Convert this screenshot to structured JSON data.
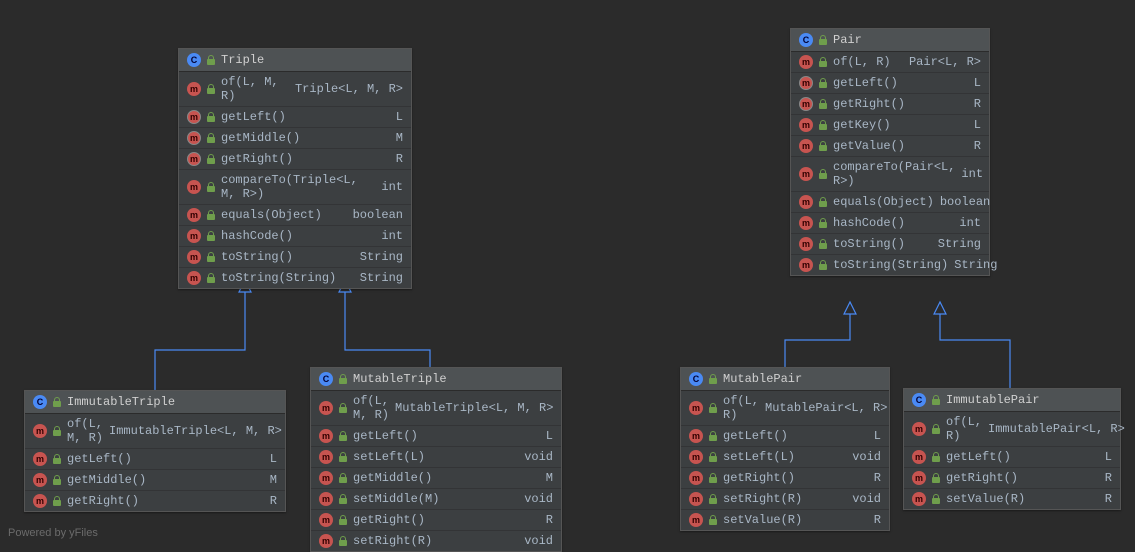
{
  "footer": "Powered by yFiles",
  "classes": {
    "triple": {
      "name": "Triple",
      "members": [
        {
          "icon": "m",
          "name": "of(L, M, R)",
          "ret": "Triple<L, M, R>"
        },
        {
          "icon": "mi",
          "name": "getLeft()",
          "ret": "L"
        },
        {
          "icon": "mi",
          "name": "getMiddle()",
          "ret": "M"
        },
        {
          "icon": "mi",
          "name": "getRight()",
          "ret": "R"
        },
        {
          "icon": "m",
          "name": "compareTo(Triple<L, M, R>)",
          "ret": "int"
        },
        {
          "icon": "m",
          "name": "equals(Object)",
          "ret": "boolean"
        },
        {
          "icon": "m",
          "name": "hashCode()",
          "ret": "int"
        },
        {
          "icon": "m",
          "name": "toString()",
          "ret": "String"
        },
        {
          "icon": "m",
          "name": "toString(String)",
          "ret": "String"
        }
      ]
    },
    "pair": {
      "name": "Pair",
      "members": [
        {
          "icon": "m",
          "name": "of(L, R)",
          "ret": "Pair<L, R>"
        },
        {
          "icon": "mi",
          "name": "getLeft()",
          "ret": "L"
        },
        {
          "icon": "mi",
          "name": "getRight()",
          "ret": "R"
        },
        {
          "icon": "m",
          "name": "getKey()",
          "ret": "L"
        },
        {
          "icon": "m",
          "name": "getValue()",
          "ret": "R"
        },
        {
          "icon": "m",
          "name": "compareTo(Pair<L, R>)",
          "ret": "int"
        },
        {
          "icon": "m",
          "name": "equals(Object)",
          "ret": "boolean"
        },
        {
          "icon": "m",
          "name": "hashCode()",
          "ret": "int"
        },
        {
          "icon": "m",
          "name": "toString()",
          "ret": "String"
        },
        {
          "icon": "m",
          "name": "toString(String)",
          "ret": "String"
        }
      ]
    },
    "immutableTriple": {
      "name": "ImmutableTriple",
      "members": [
        {
          "icon": "m",
          "name": "of(L, M, R)",
          "ret": "ImmutableTriple<L, M, R>"
        },
        {
          "icon": "m",
          "name": "getLeft()",
          "ret": "L"
        },
        {
          "icon": "m",
          "name": "getMiddle()",
          "ret": "M"
        },
        {
          "icon": "m",
          "name": "getRight()",
          "ret": "R"
        }
      ]
    },
    "mutableTriple": {
      "name": "MutableTriple",
      "members": [
        {
          "icon": "m",
          "name": "of(L, M, R)",
          "ret": "MutableTriple<L, M, R>"
        },
        {
          "icon": "m",
          "name": "getLeft()",
          "ret": "L"
        },
        {
          "icon": "m",
          "name": "setLeft(L)",
          "ret": "void"
        },
        {
          "icon": "m",
          "name": "getMiddle()",
          "ret": "M"
        },
        {
          "icon": "m",
          "name": "setMiddle(M)",
          "ret": "void"
        },
        {
          "icon": "m",
          "name": "getRight()",
          "ret": "R"
        },
        {
          "icon": "m",
          "name": "setRight(R)",
          "ret": "void"
        }
      ]
    },
    "mutablePair": {
      "name": "MutablePair",
      "members": [
        {
          "icon": "m",
          "name": "of(L, R)",
          "ret": "MutablePair<L, R>"
        },
        {
          "icon": "m",
          "name": "getLeft()",
          "ret": "L"
        },
        {
          "icon": "m",
          "name": "setLeft(L)",
          "ret": "void"
        },
        {
          "icon": "m",
          "name": "getRight()",
          "ret": "R"
        },
        {
          "icon": "m",
          "name": "setRight(R)",
          "ret": "void"
        },
        {
          "icon": "m",
          "name": "setValue(R)",
          "ret": "R"
        }
      ]
    },
    "immutablePair": {
      "name": "ImmutablePair",
      "members": [
        {
          "icon": "m",
          "name": "of(L, R)",
          "ret": "ImmutablePair<L, R>"
        },
        {
          "icon": "m",
          "name": "getLeft()",
          "ret": "L"
        },
        {
          "icon": "m",
          "name": "getRight()",
          "ret": "R"
        },
        {
          "icon": "m",
          "name": "setValue(R)",
          "ret": "R"
        }
      ]
    }
  }
}
